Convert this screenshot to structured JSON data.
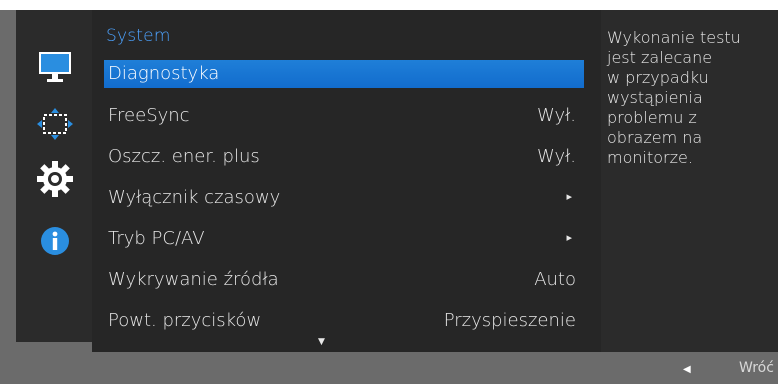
{
  "menu": {
    "title": "System",
    "items": [
      {
        "label": "Diagnostyka",
        "value": ""
      },
      {
        "label": "FreeSync",
        "value": "Wył."
      },
      {
        "label": "Oszcz. ener. plus",
        "value": "Wył."
      },
      {
        "label": "Wyłącznik czasowy",
        "arrow": "▸"
      },
      {
        "label": "Tryb PC/AV",
        "arrow": "▸"
      },
      {
        "label": "Wykrywanie źródła",
        "value": "Auto"
      },
      {
        "label": "Powt. przycisków",
        "value": "Przyspieszenie"
      }
    ],
    "scroll_down": "▼"
  },
  "info": {
    "text_lines": [
      "Wykonanie testu",
      "jest zalecane",
      "w przypadku",
      "wystąpienia",
      "problemu z",
      "obrazem na",
      "monitorze."
    ]
  },
  "footer": {
    "back_arrow": "◀",
    "back_label": "Wróć"
  },
  "sidebar": {
    "icons": [
      "monitor-icon",
      "resize-arrows-icon",
      "gear-icon",
      "info-icon"
    ],
    "accent": "#2a8ee0"
  },
  "colors": {
    "accent": "#4da3ff",
    "selected_bg": "#1877d4",
    "panel_bg": "#262626"
  }
}
